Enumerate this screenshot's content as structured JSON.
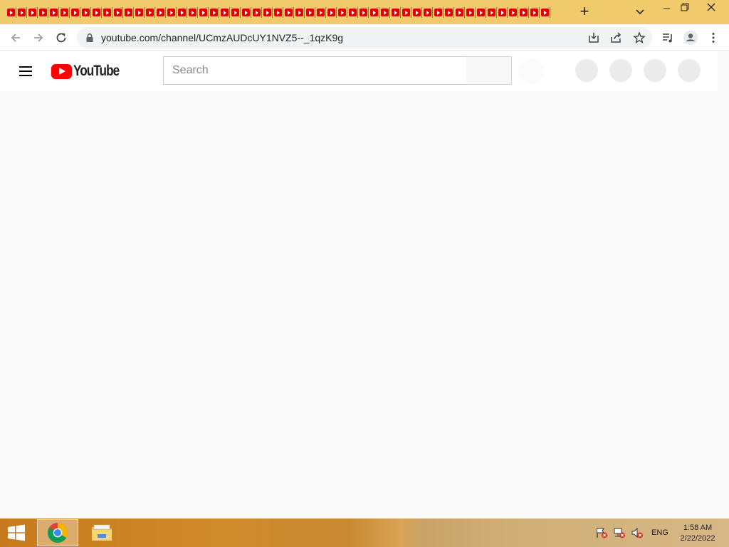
{
  "browser": {
    "tab_count": 51,
    "favicon_icon": "youtube-favicon-icon",
    "new_tab_label": "+",
    "url": "youtube.com/channel/UCmzAUDcUY1NVZ5--_1qzK9g"
  },
  "youtube": {
    "logo_text": "YouTube",
    "search_placeholder": "Search",
    "brand_color": "#ff0000"
  },
  "taskbar": {
    "language": "ENG",
    "time": "1:58 AM",
    "date": "2/22/2022",
    "apps": [
      "chrome-icon",
      "file-explorer-icon"
    ]
  }
}
